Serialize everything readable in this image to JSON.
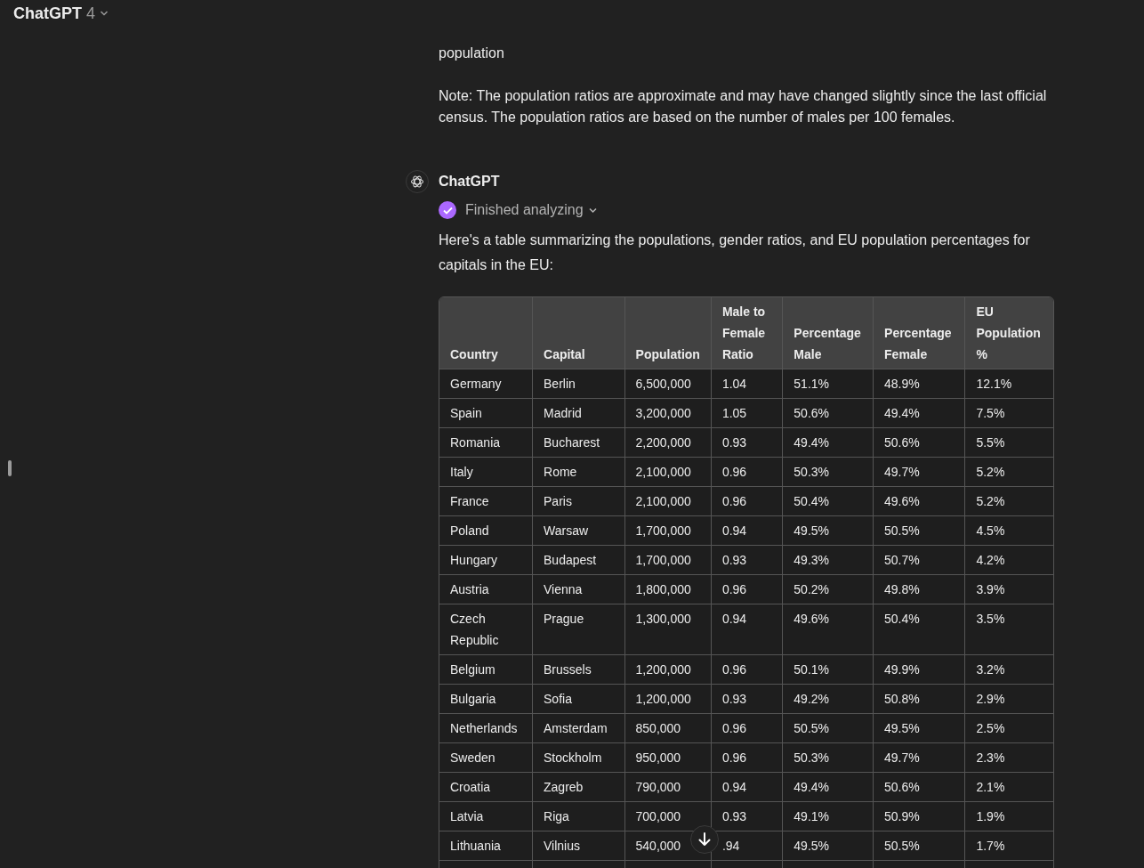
{
  "header": {
    "title": "ChatGPT",
    "version": "4"
  },
  "previous_message": {
    "tail": "population",
    "note": "Note: The population ratios are approximate and may have changed slightly since the last official census. The population ratios are based on the number of males per 100 females."
  },
  "message": {
    "author": "ChatGPT",
    "status": {
      "label": "Finished analyzing",
      "done": true
    },
    "text": "Here's a table summarizing the populations, gender ratios, and EU population percentages for capitals in the EU:"
  },
  "table": {
    "columns": [
      "Country",
      "Capital",
      "Population",
      "Male to Female Ratio",
      "Percentage Male",
      "Percentage Female",
      "EU Population %"
    ],
    "rows": [
      [
        "Germany",
        "Berlin",
        "6,500,000",
        "1.04",
        "51.1%",
        "48.9%",
        "12.1%"
      ],
      [
        "Spain",
        "Madrid",
        "3,200,000",
        "1.05",
        "50.6%",
        "49.4%",
        "7.5%"
      ],
      [
        "Romania",
        "Bucharest",
        "2,200,000",
        "0.93",
        "49.4%",
        "50.6%",
        "5.5%"
      ],
      [
        "Italy",
        "Rome",
        "2,100,000",
        "0.96",
        "50.3%",
        "49.7%",
        "5.2%"
      ],
      [
        "France",
        "Paris",
        "2,100,000",
        "0.96",
        "50.4%",
        "49.6%",
        "5.2%"
      ],
      [
        "Poland",
        "Warsaw",
        "1,700,000",
        "0.94",
        "49.5%",
        "50.5%",
        "4.5%"
      ],
      [
        "Hungary",
        "Budapest",
        "1,700,000",
        "0.93",
        "49.3%",
        "50.7%",
        "4.2%"
      ],
      [
        "Austria",
        "Vienna",
        "1,800,000",
        "0.96",
        "50.2%",
        "49.8%",
        "3.9%"
      ],
      [
        "Czech Republic",
        "Prague",
        "1,300,000",
        "0.94",
        "49.6%",
        "50.4%",
        "3.5%"
      ],
      [
        "Belgium",
        "Brussels",
        "1,200,000",
        "0.96",
        "50.1%",
        "49.9%",
        "3.2%"
      ],
      [
        "Bulgaria",
        "Sofia",
        "1,200,000",
        "0.93",
        "49.2%",
        "50.8%",
        "2.9%"
      ],
      [
        "Netherlands",
        "Amsterdam",
        "850,000",
        "0.96",
        "50.5%",
        "49.5%",
        "2.5%"
      ],
      [
        "Sweden",
        "Stockholm",
        "950,000",
        "0.96",
        "50.3%",
        "49.7%",
        "2.3%"
      ],
      [
        "Croatia",
        "Zagreb",
        "790,000",
        "0.94",
        "49.4%",
        "50.6%",
        "2.1%"
      ],
      [
        "Latvia",
        "Riga",
        "700,000",
        "0.93",
        "49.1%",
        "50.9%",
        "1.9%"
      ],
      [
        "Lithuania",
        "Vilnius",
        "540,000",
        ".94",
        "49.5%",
        "50.5%",
        "1.7%"
      ]
    ]
  }
}
